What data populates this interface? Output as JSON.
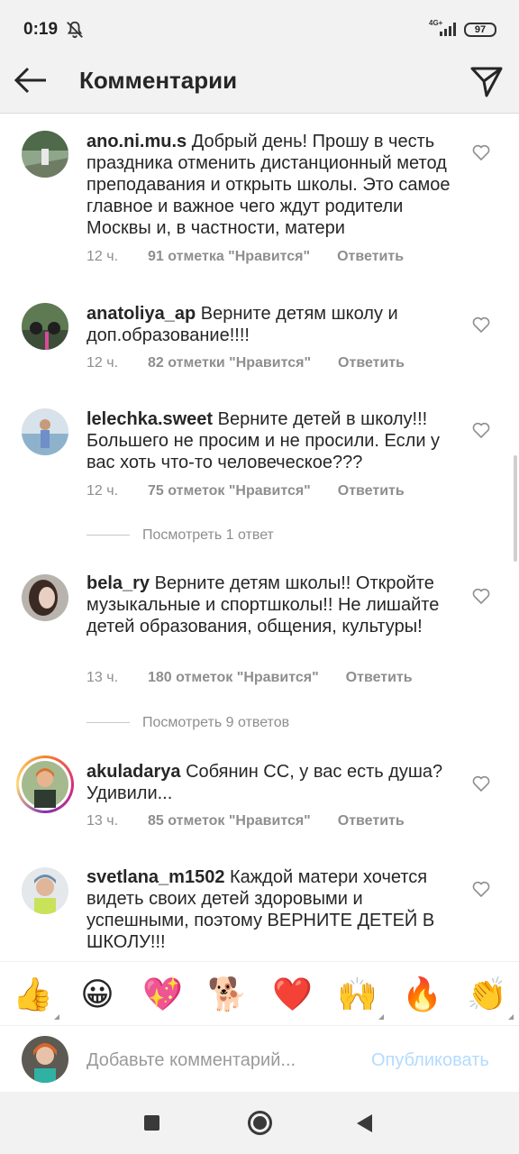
{
  "status_bar": {
    "time": "0:19",
    "network": "4G+",
    "battery": "97",
    "icons": [
      "bell-off-icon",
      "signal-icon",
      "battery-icon"
    ]
  },
  "header": {
    "title": "Комментарии",
    "back_icon": "arrow-left-icon",
    "share_icon": "paper-plane-icon"
  },
  "comments": [
    {
      "username": "ano.ni.mu.s",
      "text": "Добрый день! Прошу в честь праздника отменить дистанционный метод преподавания и открыть школы. Это самое главное и важное чего ждут родители Москвы и, в частности, матери",
      "time": "12 ч.",
      "likes": "91 отметка \"Нравится\"",
      "reply": "Ответить"
    },
    {
      "username": "anatoliya_ap",
      "text": "Верните детям школу и доп.образование!!!!",
      "time": "12 ч.",
      "likes": "82 отметки \"Нравится\"",
      "reply": "Ответить"
    },
    {
      "username": "lelechka.sweet",
      "text": "Верните детей в школу!!! Большего не просим и не просили. Если у вас хоть что-то человеческое???",
      "time": "12 ч.",
      "likes": "75 отметок \"Нравится\"",
      "reply": "Ответить",
      "view_replies": "Посмотреть 1 ответ"
    },
    {
      "username": "bela_ry",
      "text": "Верните детям школы!! Откройте музыкальные и спортшколы!! Не лишайте детей образования, общения, культуры!",
      "time": "13 ч.",
      "likes": "180 отметок \"Нравится\"",
      "reply": "Ответить",
      "view_replies": "Посмотреть 9 ответов"
    },
    {
      "username": "akuladarya",
      "text": "Собянин СС, у вас есть душа? Удивили...",
      "time": "13 ч.",
      "likes": "85 отметок \"Нравится\"",
      "reply": "Ответить"
    },
    {
      "username": "svetlana_m1502",
      "text": "Каждой матери хочется видеть своих детей здоровыми и успешными, поэтому ВЕРНИТЕ ДЕТЕЙ В ШКОЛУ!!!"
    }
  ],
  "emoji_bar": [
    "👍",
    "😀",
    "💖",
    "🐕",
    "❤️",
    "🙌",
    "🔥",
    "👏"
  ],
  "composer": {
    "placeholder": "Добавьте комментарий...",
    "publish_label": "Опубликовать"
  },
  "colors": {
    "text": "#262626",
    "secondary": "#8e8e8e",
    "publish_disabled": "#b3dbff",
    "bars": "#f2f2f2"
  }
}
